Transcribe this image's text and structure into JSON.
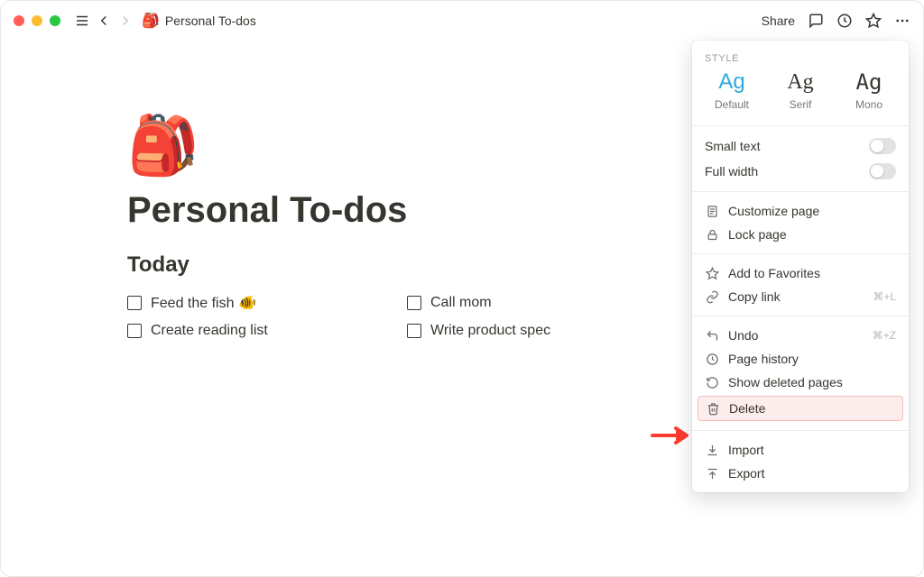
{
  "topbar": {
    "breadcrumb_emoji": "🎒",
    "breadcrumb_title": "Personal To-dos",
    "share_label": "Share"
  },
  "page": {
    "icon": "🎒",
    "title": "Personal To-dos",
    "section": "Today",
    "todos": [
      {
        "label": "Feed the fish 🐠"
      },
      {
        "label": "Call mom"
      },
      {
        "label": "Create reading list"
      },
      {
        "label": "Write product spec"
      }
    ]
  },
  "panel": {
    "style_header": "STYLE",
    "fonts": {
      "default": {
        "sample": "Ag",
        "name": "Default"
      },
      "serif": {
        "sample": "Ag",
        "name": "Serif"
      },
      "mono": {
        "sample": "Ag",
        "name": "Mono"
      }
    },
    "small_text": "Small text",
    "full_width": "Full width",
    "customize_page": "Customize page",
    "lock_page": "Lock page",
    "add_to_favorites": "Add to Favorites",
    "copy_link": "Copy link",
    "copy_link_shortcut": "⌘+L",
    "undo": "Undo",
    "undo_shortcut": "⌘+Z",
    "page_history": "Page history",
    "show_deleted": "Show deleted pages",
    "delete": "Delete",
    "import": "Import",
    "export": "Export"
  }
}
